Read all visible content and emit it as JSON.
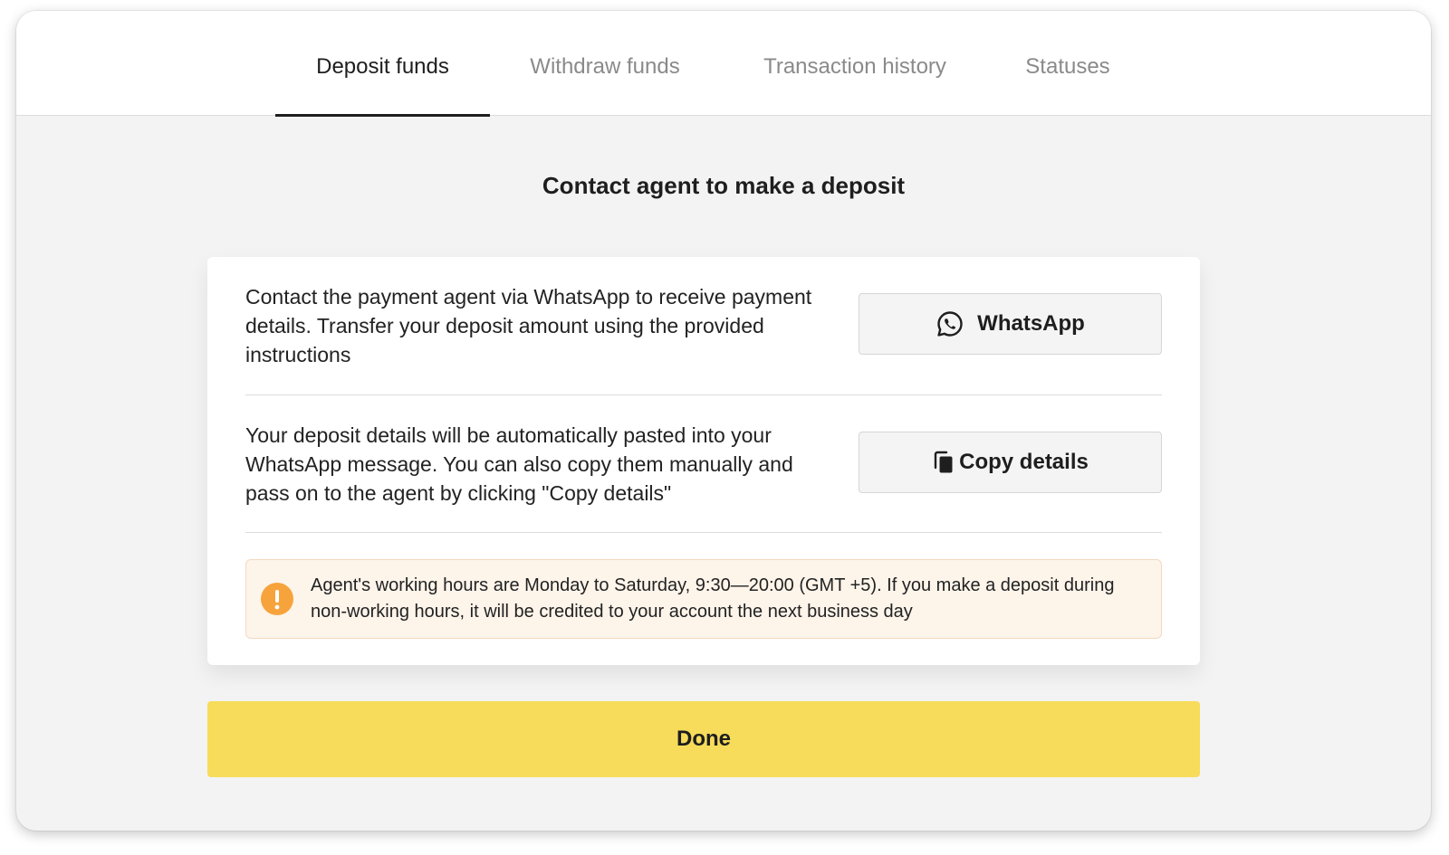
{
  "tabs": [
    {
      "label": "Deposit funds",
      "active": true
    },
    {
      "label": "Withdraw funds",
      "active": false
    },
    {
      "label": "Transaction history",
      "active": false
    },
    {
      "label": "Statuses",
      "active": false
    }
  ],
  "heading": "Contact agent to make a deposit",
  "steps": [
    {
      "text": "Contact the payment agent via WhatsApp to receive payment details. Transfer your deposit amount using the provided instructions",
      "button_label": "WhatsApp",
      "button_icon": "whatsapp-icon"
    },
    {
      "text": "Your deposit details will be automatically pasted into your WhatsApp message. You can also copy them manually and pass on to the agent by clicking \"Copy details\"",
      "button_label": "Copy details",
      "button_icon": "copy-icon"
    }
  ],
  "notice": {
    "icon": "warning-icon",
    "text": "Agent's working hours are Monday to Saturday, 9:30—20:00 (GMT +5). If you make a deposit during non-working hours, it will be credited to your account the next business day"
  },
  "done_label": "Done",
  "colors": {
    "accent_yellow": "#f6dc5a",
    "warning_orange": "#f7a33b",
    "notice_background": "#fdf4ea",
    "text_primary": "#1e1e1e",
    "text_muted": "#8a8a8a"
  }
}
